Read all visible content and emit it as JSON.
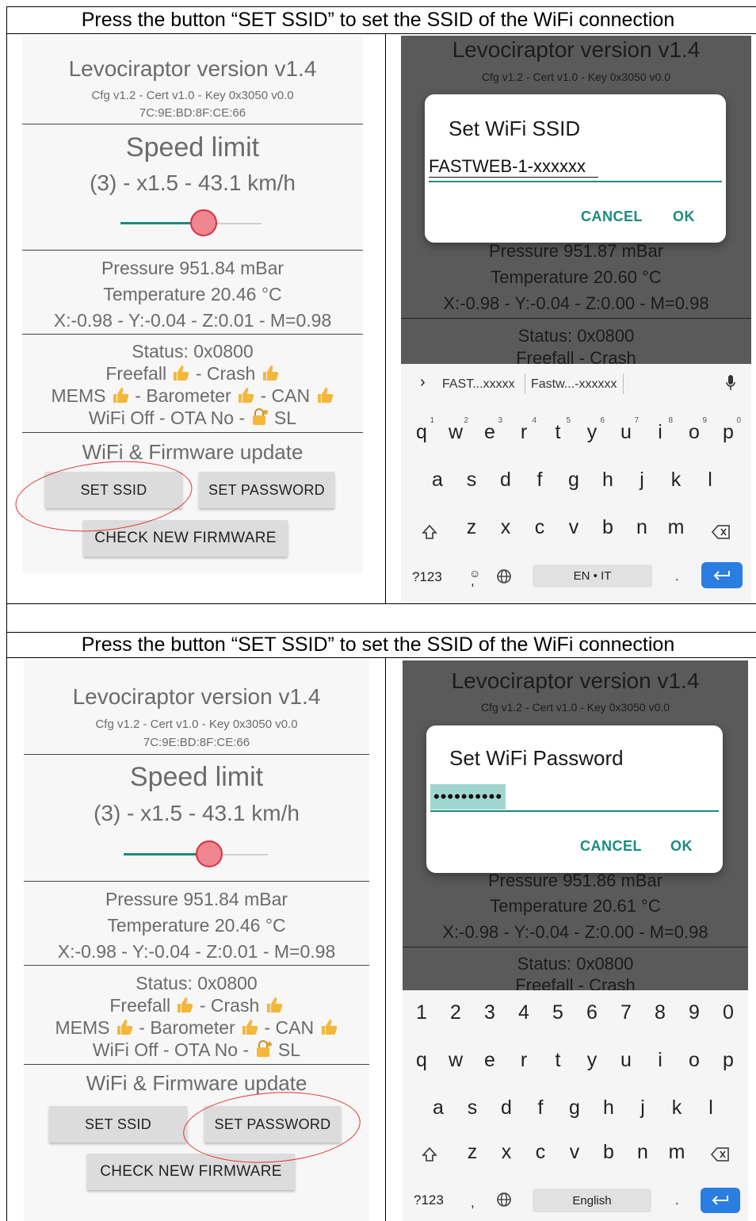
{
  "caption": "Press the button “SET SSID” to set the SSID of the WiFi connection",
  "app": {
    "title": "Levociraptor version v1.4",
    "cfg": "Cfg v1.2 - Cert v1.0 - Key 0x3050 v0.0",
    "mac": "7C:9E:BD:8F:CE:66",
    "speed_title": "Speed limit",
    "speed_value": "(3) - x1.5 - 43.1 km/h",
    "slider_level": 0.6,
    "pressure": "Pressure 951.84 mBar",
    "temperature": "Temperature 20.46 °C",
    "accel": "X:-0.98 - Y:-0.04 - Z:0.01 - M=0.98",
    "status": "Status: 0x0800",
    "freefall_label": "Freefall",
    "crash_label": "- Crash",
    "mems_label": "MEMS",
    "barometer_label": "- Barometer",
    "can_label": "- CAN",
    "wifi_prefix": "WiFi Off - OTA No -",
    "wifi_suffix": "SL",
    "section": "WiFi & Firmware update",
    "set_ssid": "SET SSID",
    "set_password": "SET PASSWORD",
    "check_fw": "CHECK NEW FIRMWARE"
  },
  "phone1": {
    "bg_title": "Levociraptor version v1.4",
    "bg_cfg": "Cfg v1.2 - Cert v1.0 - Key 0x3050 v0.0",
    "bg_pressure": "Pressure 951.87 mBar",
    "bg_temperature": "Temperature 20.60 °C",
    "bg_accel": "X:-0.98 - Y:-0.04 - Z:0.00 - M=0.98",
    "bg_status": "Status: 0x0800",
    "bg_freefall": "Freefall",
    "bg_crash": "- Crash",
    "dialog_title": "Set WiFi SSID",
    "dialog_value": "FASTWEB-1-xxxxxx",
    "cancel": "CANCEL",
    "ok": "OK",
    "suggestion_1": "FAST...xxxxx",
    "suggestion_2": "Fastw...-xxxxxx",
    "row1": [
      "q",
      "w",
      "e",
      "r",
      "t",
      "y",
      "u",
      "i",
      "o",
      "p"
    ],
    "row1_hints": [
      "1",
      "2",
      "3",
      "4",
      "5",
      "6",
      "7",
      "8",
      "9",
      "0"
    ],
    "row2": [
      "a",
      "s",
      "d",
      "f",
      "g",
      "h",
      "j",
      "k",
      "l"
    ],
    "row3": [
      "z",
      "x",
      "c",
      "v",
      "b",
      "n",
      "m"
    ],
    "sym": "?123",
    "comma": ",",
    "space": "EN • IT",
    "period": "."
  },
  "phone2": {
    "bg_title": "Levociraptor version v1.4",
    "bg_cfg": "Cfg v1.2 - Cert v1.0 - Key 0x3050 v0.0",
    "bg_pressure": "Pressure 951.86 mBar",
    "bg_temperature": "Temperature 20.61 °C",
    "bg_accel": "X:-0.98 - Y:-0.04 - Z:0.00 - M=0.98",
    "bg_status": "Status: 0x0800",
    "bg_freefall": "Freefall",
    "bg_crash": "- Crash",
    "dialog_title": "Set WiFi Password",
    "dialog_value": "••••••••••",
    "cancel": "CANCEL",
    "ok": "OK",
    "row0": [
      "1",
      "2",
      "3",
      "4",
      "5",
      "6",
      "7",
      "8",
      "9",
      "0"
    ],
    "row1": [
      "q",
      "w",
      "e",
      "r",
      "t",
      "y",
      "u",
      "i",
      "o",
      "p"
    ],
    "row2": [
      "a",
      "s",
      "d",
      "f",
      "g",
      "h",
      "j",
      "k",
      "l"
    ],
    "row3": [
      "z",
      "x",
      "c",
      "v",
      "b",
      "n",
      "m"
    ],
    "sym": "?123",
    "comma": ",",
    "space": "English",
    "period": "."
  },
  "colors": {
    "accent": "#1a8b7e",
    "thumb": "#f0868f",
    "highlight_ring": "#e23030",
    "enter_key": "#2a7de1"
  }
}
